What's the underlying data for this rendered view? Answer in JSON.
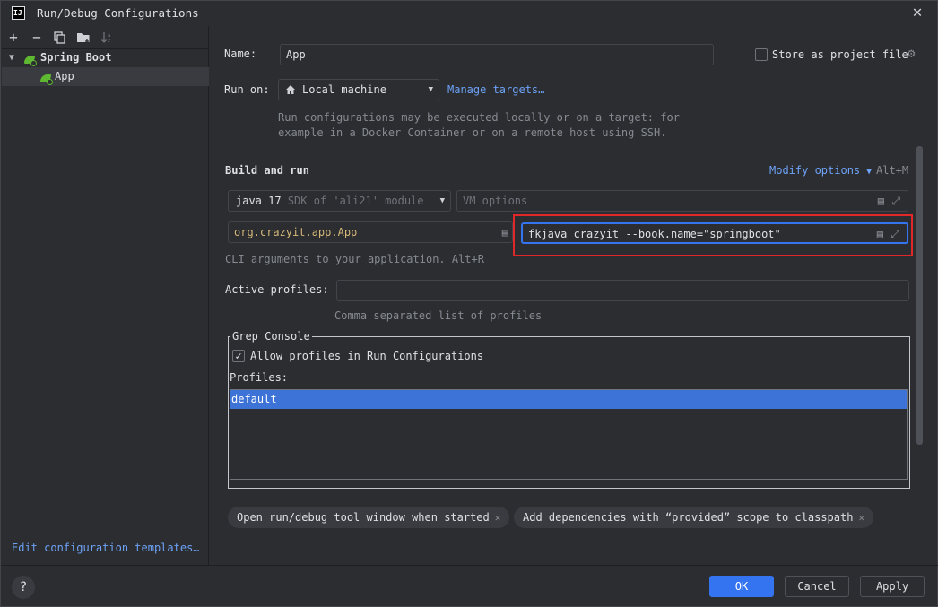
{
  "window": {
    "title": "Run/Debug Configurations",
    "logo_text": "IJ"
  },
  "left": {
    "toolbar": {
      "add_icon": "+",
      "remove_icon": "−"
    },
    "tree": [
      {
        "label": "Spring Boot",
        "expanded": true
      },
      {
        "label": "App",
        "selected": true
      }
    ],
    "edit_templates": "Edit configuration templates…"
  },
  "form": {
    "name_label": "Name:",
    "name_value": "App",
    "store_label": "Store as project file",
    "store_checked": false,
    "run_on_label": "Run on:",
    "run_on_value": "Local machine",
    "manage_targets": "Manage targets…",
    "run_on_hint_1": "Run configurations may be executed locally or on a target: for",
    "run_on_hint_2": "example in a Docker Container or on a remote host using SSH.",
    "build_run_title": "Build and run",
    "modify_options": "Modify options",
    "modify_shortcut": "Alt+M",
    "sdk_java": "java 17",
    "sdk_desc": "SDK of 'ali21' module",
    "vm_options_placeholder": "VM options",
    "main_class": "org.crazyit.app.App",
    "program_args": "fkjava crazyit --book.name=\"springboot\"",
    "cli_hint": "CLI arguments to your application. Alt+R",
    "active_profiles_label": "Active profiles:",
    "active_profiles_value": "",
    "profiles_hint": "Comma separated list of profiles",
    "grep_console_title": "Grep Console",
    "allow_profiles_label": "Allow profiles in Run Configurations",
    "allow_profiles_checked": true,
    "profiles_label": "Profiles:",
    "profiles_list": [
      "default"
    ],
    "chips": [
      "Open run/debug tool window when started",
      "Add dependencies with “provided” scope to classpath"
    ],
    "highlight_color": "#e0282b",
    "accent_color": "#3574f0"
  },
  "footer": {
    "help": "?",
    "ok": "OK",
    "cancel": "Cancel",
    "apply": "Apply"
  }
}
